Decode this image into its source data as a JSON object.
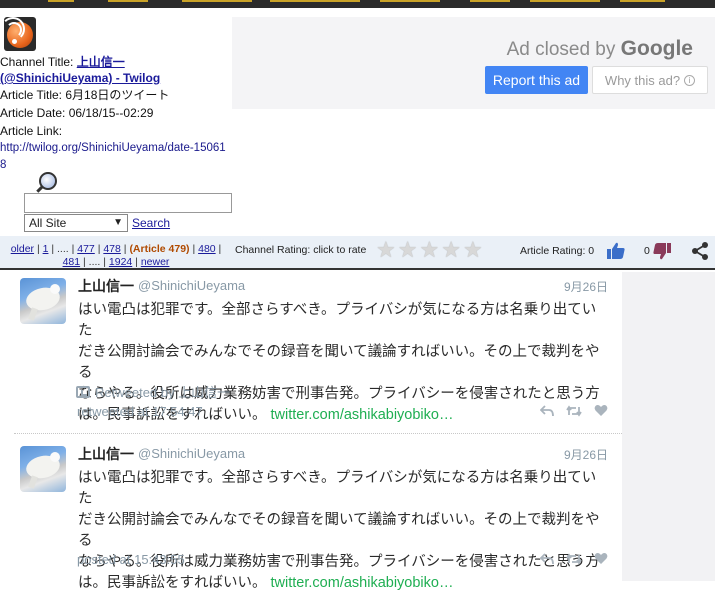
{
  "colors": {
    "nav_bg": "#eaf0f7",
    "ad_bg": "#f4f4f6",
    "report_button": "#4285f4",
    "link": "#1a1a9a",
    "current_article": "#b04a00",
    "tweet_link": "#1fae52",
    "thumb_up": "#3b6ec9",
    "thumb_down": "#8a3a5a"
  },
  "header": {
    "icon": "rss-feed-icon",
    "channel_title_label": "Channel Title:",
    "channel_title": "上山信一 (@ShinichiUeyama) - Twilog",
    "article_title_label": "Article Title:",
    "article_title": "6月18日のツイート",
    "article_date_label": "Article Date:",
    "article_date": "06/18/15--02:29",
    "article_link_label": "Article Link:",
    "article_link": "http://twilog.org/ShinichiUeyama/date-150618"
  },
  "ad": {
    "closed_text": "Ad closed by",
    "brand": "Google",
    "report_label": "Report this ad",
    "why_label": "Why this ad?"
  },
  "search": {
    "input_value": "",
    "scope_selected": "All Site",
    "search_label": "Search"
  },
  "nav": {
    "older": "older",
    "p1": "1",
    "ellipsis": "....",
    "p477": "477",
    "p478": "478",
    "current": "(Article 479)",
    "p480": "480",
    "p481": "481",
    "p1924": "1924",
    "newer": "newer",
    "channel_rating_label": "Channel Rating: click to rate",
    "channel_rating_stars": 5,
    "article_rating_label": "Article Rating:",
    "thumbs_up_count": "0",
    "thumbs_down_count": "0"
  },
  "tweets": [
    {
      "name": "上山信一",
      "handle": "@ShinichiUeyama",
      "date": "9月26日",
      "text_line1": "はい電凸は犯罪です。全部さらすべき。プライバシが気になる方は名乗り出ていた",
      "text_line2": "だき公開討論会でみんなでその録音を聞いて議論すればいい。その上で裁判をやる",
      "text_line3": "ならやる。役所は威力業務妨害で刑事告発。プライバシーを侵害されたと思う方",
      "text_line4": "は。民事訴訟をすればいい。",
      "link": "twitter.com/ashikabiyobiko…",
      "retweet_text": "Retweeted by 上山信一",
      "timestamp": "retweeted at 17:54:47"
    },
    {
      "name": "上山信一",
      "handle": "@ShinichiUeyama",
      "date": "9月26日",
      "text_line1": "はい電凸は犯罪です。全部さらすべき。プライバシが気になる方は名乗り出ていた",
      "text_line2": "だき公開討論会でみんなでその録音を聞いて議論すればいい。その上で裁判をやる",
      "text_line3": "ならやる。役所は威力業務妨害で刑事告発。プライバシーを侵害されたと思う方",
      "text_line4": "は。民事訴訟をすればいい。",
      "link": "twitter.com/ashikabiyobiko…",
      "timestamp": "posted at 15:43:55"
    }
  ]
}
